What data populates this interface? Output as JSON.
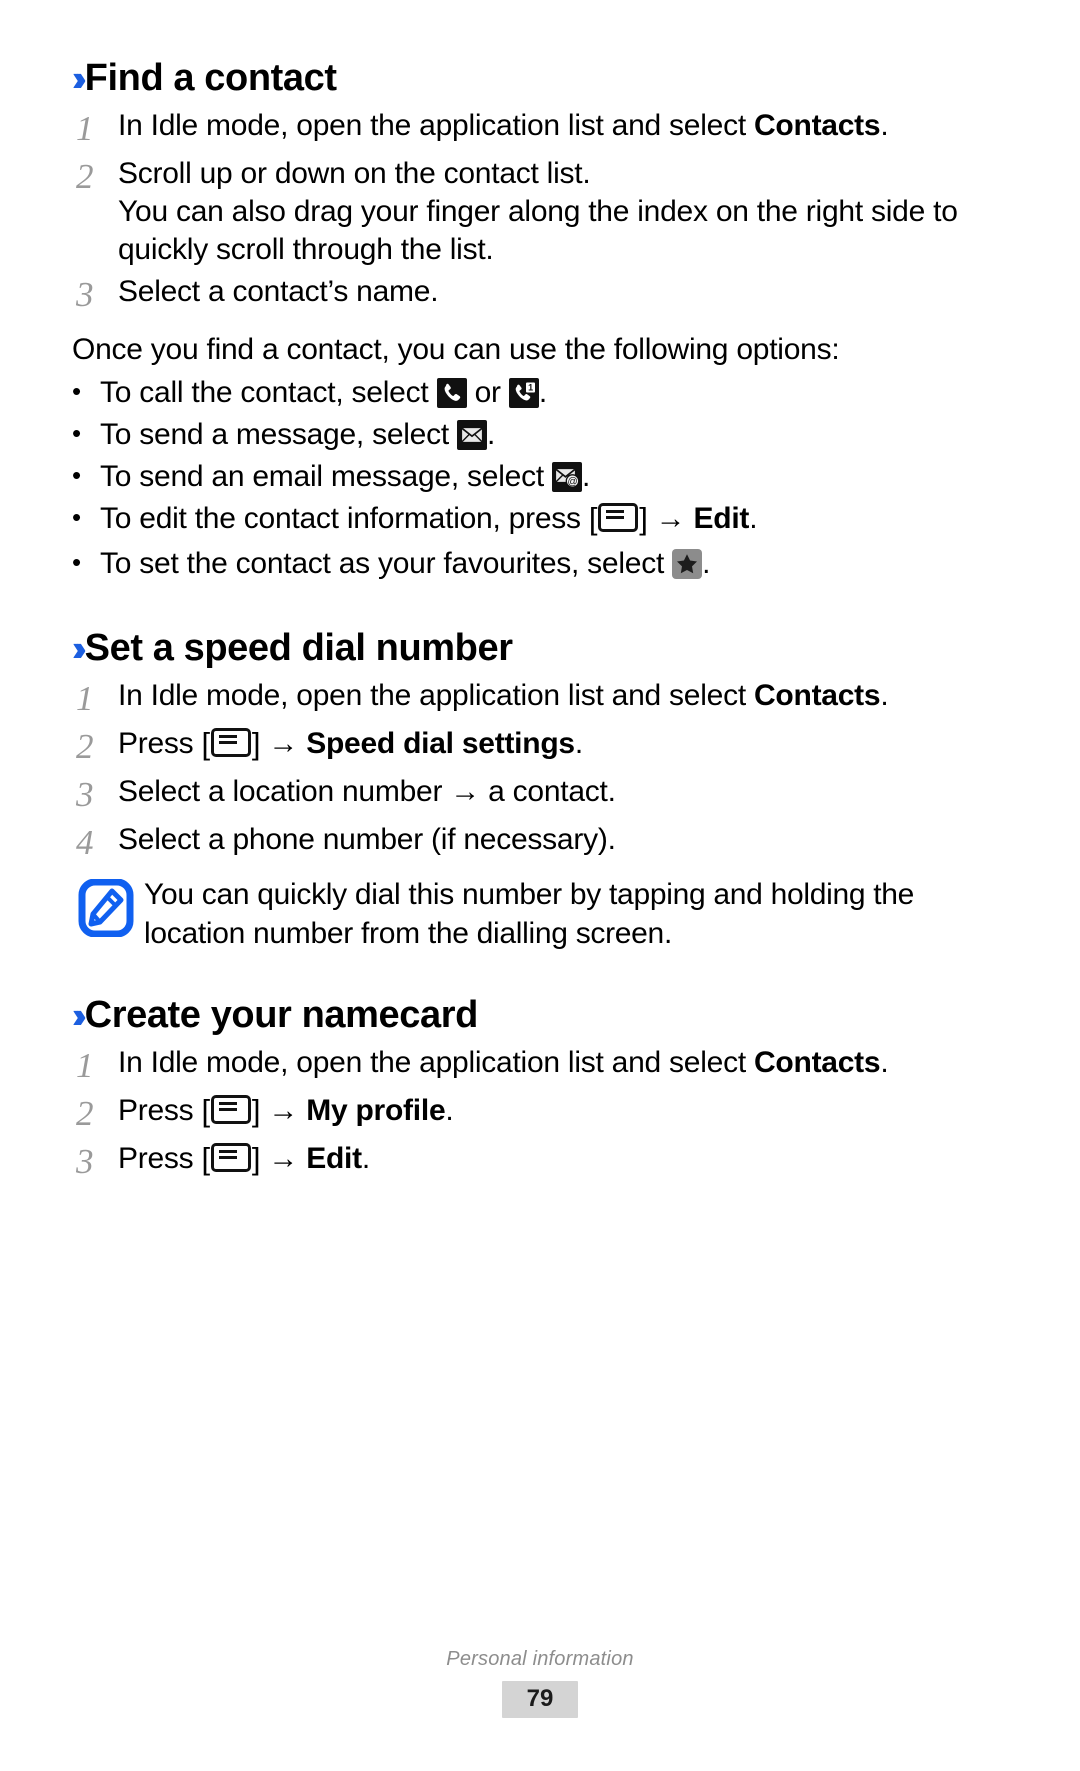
{
  "document": {
    "footer_title": "Personal information",
    "page_number": "79",
    "accent_color": "#1c5fe0"
  },
  "sections": [
    {
      "heading": "Find a contact",
      "steps": [
        {
          "num": "1",
          "text_before": "In Idle mode, open the application list and select ",
          "bold": "Contacts",
          "text_after": "."
        },
        {
          "num": "2",
          "text_before": "Scroll up or down on the contact list.",
          "extra": "You can also drag your finger along the index on the right side to quickly scroll through the list."
        },
        {
          "num": "3",
          "text_before": "Select a contact’s name."
        }
      ],
      "paragraph": "Once you find a contact, you can use the following options:",
      "bullets": [
        {
          "pre": "To call the contact, select ",
          "icon1": "phone-call-icon",
          "mid": " or ",
          "icon2": "video-call-icon",
          "post": "."
        },
        {
          "pre": "To send a message, select ",
          "icon1": "envelope-message-icon",
          "post": "."
        },
        {
          "pre": "To send an email message, select ",
          "icon1": "envelope-email-icon",
          "post": "."
        },
        {
          "pre": "To edit the contact information, press ",
          "icon1": "menu-key-icon",
          "mid": " → ",
          "bold": "Edit",
          "post": "."
        },
        {
          "pre": "To set the contact as your favourites, select ",
          "icon1": "star-favourite-icon",
          "post": "."
        }
      ]
    },
    {
      "heading": "Set a speed dial number",
      "steps": [
        {
          "num": "1",
          "text_before": "In Idle mode, open the application list and select ",
          "bold": "Contacts",
          "text_after": "."
        },
        {
          "num": "2",
          "text_before": "Press ",
          "icon": "menu-key-icon",
          "mid": " → ",
          "bold": "Speed dial settings",
          "text_after": "."
        },
        {
          "num": "3",
          "text_before": "Select a location number → a contact."
        },
        {
          "num": "4",
          "text_before": "Select a phone number (if necessary)."
        }
      ],
      "note": {
        "icon": "note-pencil-icon",
        "text": "You can quickly dial this number by tapping and holding the location number from the dialling screen."
      }
    },
    {
      "heading": "Create your namecard",
      "steps": [
        {
          "num": "1",
          "text_before": "In Idle mode, open the application list and select ",
          "bold": "Contacts",
          "text_after": "."
        },
        {
          "num": "2",
          "text_before": "Press ",
          "icon": "menu-key-icon",
          "mid": " → ",
          "bold": "My profile",
          "text_after": "."
        },
        {
          "num": "3",
          "text_before": "Press ",
          "icon": "menu-key-icon",
          "mid": " → ",
          "bold": "Edit",
          "text_after": "."
        }
      ]
    }
  ]
}
